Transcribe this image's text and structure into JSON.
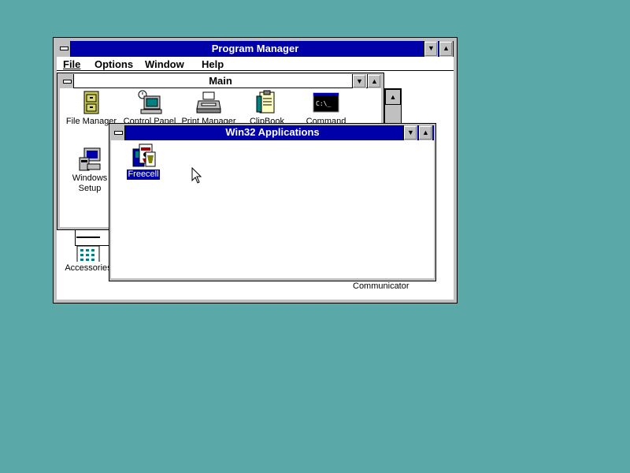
{
  "desktop": {
    "background": "#5ba8a8"
  },
  "program_manager": {
    "title": "Program Manager",
    "menu": {
      "file": "File",
      "options": "Options",
      "window": "Window",
      "help": "Help"
    },
    "partial_labels": {
      "accessories": "Accessories",
      "communicator": "Communicator"
    }
  },
  "main_group": {
    "title": "Main",
    "icons": {
      "file_manager": "File Manager",
      "control_panel": "Control Panel",
      "print_manager": "Print Manager",
      "clipbook": "ClipBook",
      "command": "Command",
      "windows_setup_line1": "Windows",
      "windows_setup_line2": "Setup"
    }
  },
  "win32_group": {
    "title": "Win32 Applications",
    "icons": {
      "freecell": "Freecell"
    }
  },
  "icon_names": {
    "minimize": "chevron-down-icon",
    "maximize": "chevron-up-icon",
    "system_menu": "system-menu-icon"
  },
  "colors": {
    "title_active": "#0000a8",
    "selection": "#0000a8"
  }
}
